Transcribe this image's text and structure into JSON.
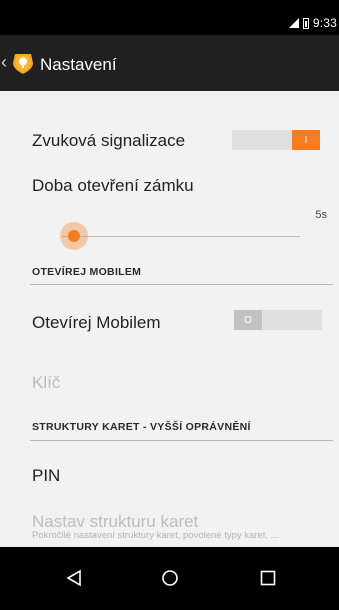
{
  "status_bar": {
    "time": "9:33",
    "signal_icon": "signal-icon",
    "battery_icon": "battery-icon"
  },
  "action_bar": {
    "title": "Nastavení",
    "back_icon": "back-arrow-icon",
    "app_icon": "app-logo-icon"
  },
  "settings": {
    "sound": {
      "title": "Zvuková signalizace",
      "state": "on",
      "switch_text": "I"
    },
    "unlock_time": {
      "title": "Doba otevření zámku",
      "value": "5s",
      "level": 0.05
    },
    "section_mobile": {
      "title": "OTEVÍREJ MOBILEM"
    },
    "open_mobile": {
      "title": "Otevírej Mobilem",
      "state": "off",
      "switch_text": "O"
    },
    "key": {
      "title": "Klíč",
      "enabled": false
    },
    "section_cards": {
      "title": "STRUKTURY KARET - VYŠŠÍ OPRÁVNĚNÍ"
    },
    "pin": {
      "title": "PIN"
    },
    "card_structure": {
      "title": "Nastav strukturu karet",
      "summary": "Pokročilé nastavení struktury karet, povolené typy karet, ...",
      "enabled": false
    }
  },
  "colors": {
    "accent": "#f57c1f",
    "action_bar": "#202020",
    "background": "#f2f2f2"
  },
  "nav_bar": {
    "back_icon": "nav-back-icon",
    "home_icon": "nav-home-icon",
    "recents_icon": "nav-recents-icon"
  }
}
